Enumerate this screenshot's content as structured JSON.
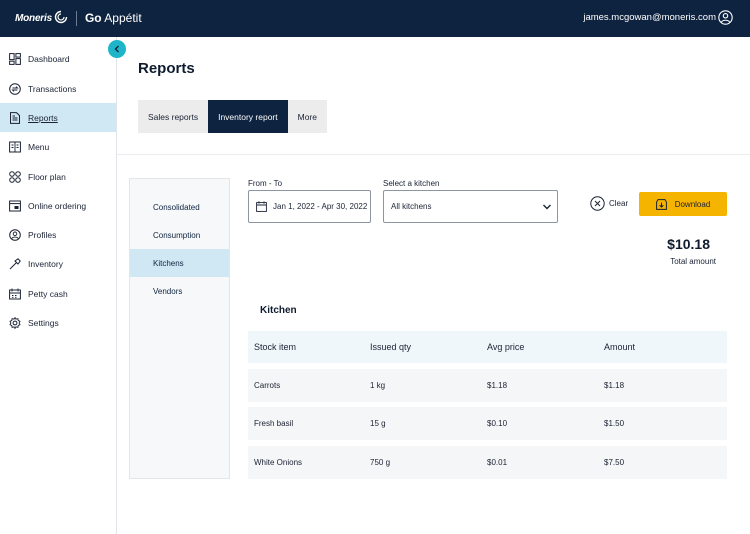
{
  "header": {
    "brand_moneris": "Moneris",
    "brand_go": "Go",
    "brand_appetit": "Appétit",
    "user_email": "james.mcgowan@moneris.com"
  },
  "sidebar": {
    "items": [
      {
        "label": "Dashboard",
        "icon": "dashboard-icon"
      },
      {
        "label": "Transactions",
        "icon": "transactions-icon"
      },
      {
        "label": "Reports",
        "icon": "reports-icon",
        "active": true
      },
      {
        "label": "Menu",
        "icon": "menu-book-icon"
      },
      {
        "label": "Floor plan",
        "icon": "floor-plan-icon"
      },
      {
        "label": "Online ordering",
        "icon": "online-ordering-icon"
      },
      {
        "label": "Profiles",
        "icon": "profiles-icon"
      },
      {
        "label": "Inventory",
        "icon": "inventory-icon"
      },
      {
        "label": "Petty cash",
        "icon": "petty-cash-icon"
      },
      {
        "label": "Settings",
        "icon": "settings-gear-icon"
      }
    ]
  },
  "page": {
    "title": "Reports",
    "tabs": [
      {
        "label": "Sales reports"
      },
      {
        "label": "Inventory report",
        "active": true
      },
      {
        "label": "More"
      }
    ]
  },
  "subnav": {
    "items": [
      {
        "label": "Consolidated"
      },
      {
        "label": "Consumption"
      },
      {
        "label": "Kitchens",
        "active": true
      },
      {
        "label": "Vendors"
      }
    ]
  },
  "filters": {
    "date_label": "From - To",
    "date_value": "Jan 1, 2022 - Apr 30, 2022",
    "kitchen_label": "Select a kitchen",
    "kitchen_value": "All kitchens",
    "clear_label": "Clear",
    "download_label": "Download"
  },
  "summary": {
    "total_value": "$10.18",
    "total_label": "Total amount"
  },
  "table": {
    "title": "Kitchen",
    "columns": [
      "Stock item",
      "Issued qty",
      "Avg price",
      "Amount"
    ],
    "rows": [
      [
        "Carrots",
        "1 kg",
        "$1.18",
        "$1.18"
      ],
      [
        "Fresh basil",
        "15 g",
        "$0.10",
        "$1.50"
      ],
      [
        "White Onions",
        "750 g",
        "$0.01",
        "$7.50"
      ]
    ]
  },
  "colors": {
    "topbar": "#0e2340",
    "active_nav": "#cfe8f3",
    "accent_collapse": "#1fb5c8",
    "download": "#f5b400"
  }
}
